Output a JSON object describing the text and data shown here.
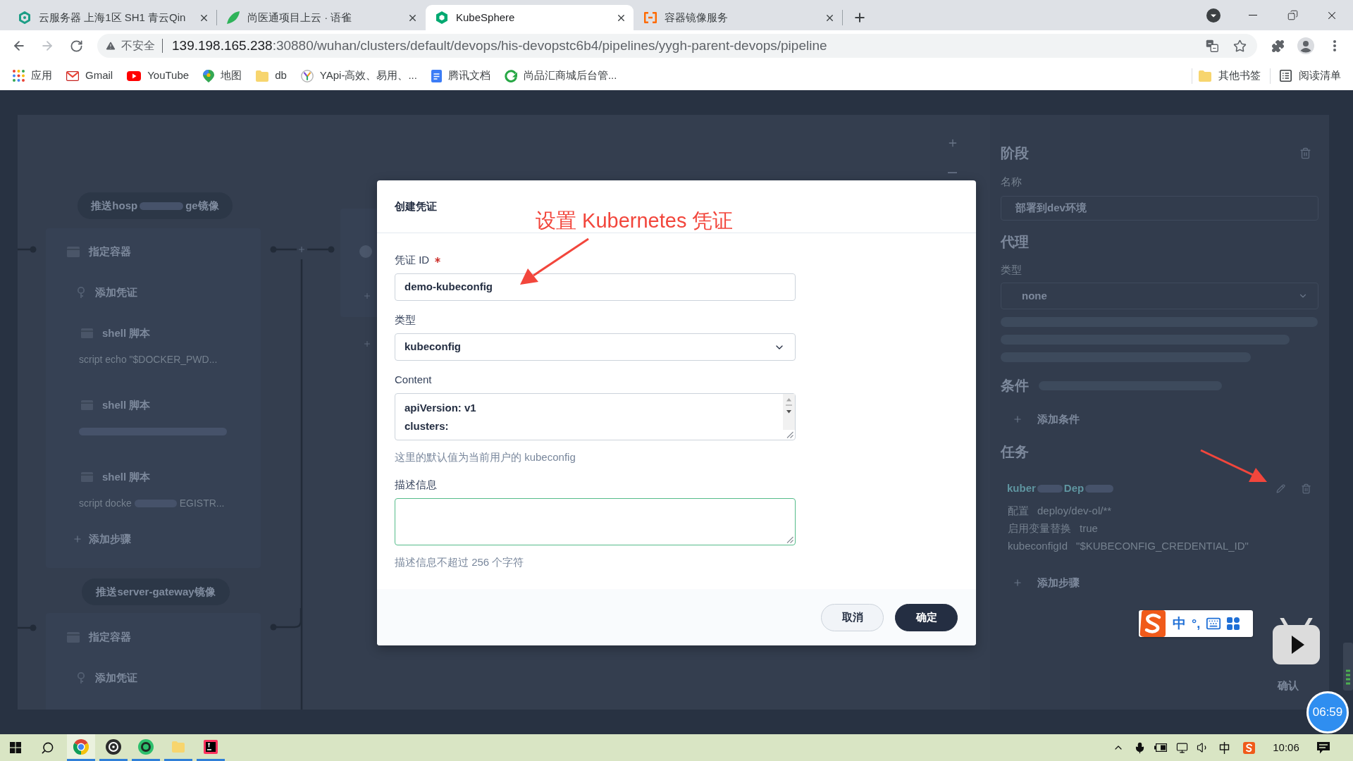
{
  "browser": {
    "tabs": [
      {
        "kind": "hexagon",
        "title": "云服务器 上海1区 SH1 青云Qin",
        "selected": false
      },
      {
        "kind": "bird",
        "title": "尚医通项目上云 · 语雀",
        "selected": false
      },
      {
        "kind": "cube",
        "title": "KubeSphere",
        "selected": true
      },
      {
        "kind": "bracket",
        "title": "容器镜像服务",
        "selected": false
      }
    ],
    "address": {
      "security": "不安全",
      "host": "139.198.165.238",
      "path": ":30880/wuhan/clusters/default/devops/his-devopstc6b4/pipelines/yygh-parent-devops/pipeline"
    },
    "bookmarks": [
      {
        "kind": "apps",
        "label": "应用"
      },
      {
        "kind": "mail",
        "label": "Gmail"
      },
      {
        "kind": "video",
        "label": "YouTube"
      },
      {
        "kind": "map",
        "label": "地图"
      },
      {
        "kind": "folder",
        "label": "db"
      },
      {
        "kind": "fork",
        "label": "YApi-高效、易用、..."
      },
      {
        "kind": "doc",
        "label": "腾讯文档"
      },
      {
        "kind": "refresh",
        "label": "尚品汇商城后台管..."
      }
    ],
    "bookmarks_right": [
      {
        "kind": "folder",
        "label": "其他书签"
      },
      {
        "kind": "list",
        "label": "阅读清单"
      }
    ]
  },
  "pipeline": {
    "stages": [
      {
        "title_parts": [
          "推送hosp",
          "ge镜像"
        ],
        "steps": [
          {
            "kind": "container",
            "label": "指定容器"
          },
          {
            "kind": "credential",
            "label": "添加凭证"
          },
          {
            "kind": "shell",
            "label": "shell 脚本",
            "detail_parts": [
              "script  echo \"$DOCKER_PWD..."
            ]
          },
          {
            "kind": "shell",
            "label": "shell 脚本"
          },
          {
            "kind": "shell",
            "label": "shell 脚本",
            "detail_parts": [
              "script  docke",
              "EGISTR..."
            ]
          }
        ],
        "add_step": "添加步骤"
      },
      {
        "title_parts": [
          "推送server-gateway镜像"
        ],
        "steps": [
          {
            "kind": "container",
            "label": "指定容器"
          },
          {
            "kind": "credential",
            "label": "添加凭证"
          }
        ]
      }
    ]
  },
  "side_panel": {
    "stage_heading": "阶段",
    "name_label": "名称",
    "name_value": "部署到dev环境",
    "agent_heading": "代理",
    "agent_type_label": "类型",
    "agent_type_value": "none",
    "condition_heading": "条件",
    "add_condition": "添加条件",
    "tasks_heading": "任务",
    "task": {
      "title_parts": [
        "kuber",
        "Dep"
      ],
      "properties": [
        {
          "key": "配置",
          "value": "deploy/dev-ol/**"
        },
        {
          "key": "启用变量替换",
          "value": "true"
        },
        {
          "key": "kubeconfigId",
          "value": "\"$KUBECONFIG_CREDENTIAL_ID\""
        }
      ]
    },
    "add_step": "添加步骤",
    "confirm": "确认"
  },
  "dialog": {
    "title": "创建凭证",
    "fields": [
      {
        "kind": "input",
        "label": "凭证 ID",
        "required": true,
        "value": "demo-kubeconfig",
        "focused": false
      },
      {
        "kind": "select",
        "label": "类型",
        "required": false,
        "value": "kubeconfig",
        "focused": false
      },
      {
        "kind": "textarea",
        "label": "Content",
        "required": false,
        "lines": [
          "apiVersion: v1",
          "clusters:"
        ],
        "hint": "这里的默认值为当前用户的 kubeconfig",
        "focused": false
      },
      {
        "kind": "textarea",
        "label": "描述信息",
        "required": false,
        "hint": "描述信息不超过 256 个字符",
        "focused": true
      }
    ],
    "buttons": [
      {
        "kind": "secondary",
        "label": "取消"
      },
      {
        "kind": "primary",
        "label": "确定"
      }
    ]
  },
  "annotation": {
    "text": "设置 Kubernetes 凭证"
  },
  "overlays": {
    "ime_mode": "中",
    "ime_punct": "°,",
    "timer": "06:59"
  },
  "taskbar": {
    "apps": [
      {
        "kind": "browser",
        "selected": true
      },
      {
        "kind": "disc",
        "selected": false
      },
      {
        "kind": "ring",
        "selected": false
      },
      {
        "kind": "folder",
        "selected": false
      },
      {
        "kind": "editor",
        "selected": false
      }
    ],
    "time": "10:06"
  }
}
